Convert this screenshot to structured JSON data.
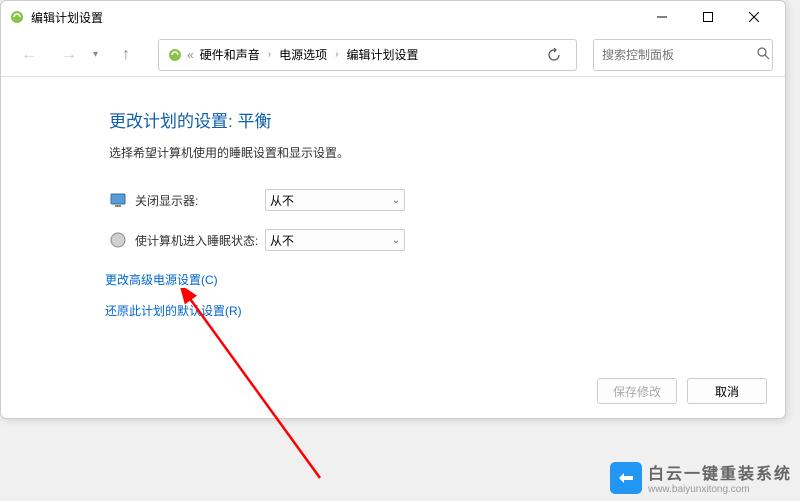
{
  "titlebar": {
    "title": "编辑计划设置"
  },
  "breadcrumb": {
    "items": [
      "硬件和声音",
      "电源选项",
      "编辑计划设置"
    ]
  },
  "search": {
    "placeholder": "搜索控制面板"
  },
  "page": {
    "title": "更改计划的设置: 平衡",
    "description": "选择希望计算机使用的睡眠设置和显示设置。"
  },
  "settings": {
    "display_off_label": "关闭显示器:",
    "display_off_value": "从不",
    "sleep_label": "使计算机进入睡眠状态:",
    "sleep_value": "从不"
  },
  "links": {
    "advanced": "更改高级电源设置(C)",
    "restore": "还原此计划的默认设置(R)"
  },
  "buttons": {
    "save": "保存修改",
    "cancel": "取消"
  },
  "watermark": {
    "title": "白云一键重装系统",
    "url": "www.baiyunxitong.com"
  }
}
